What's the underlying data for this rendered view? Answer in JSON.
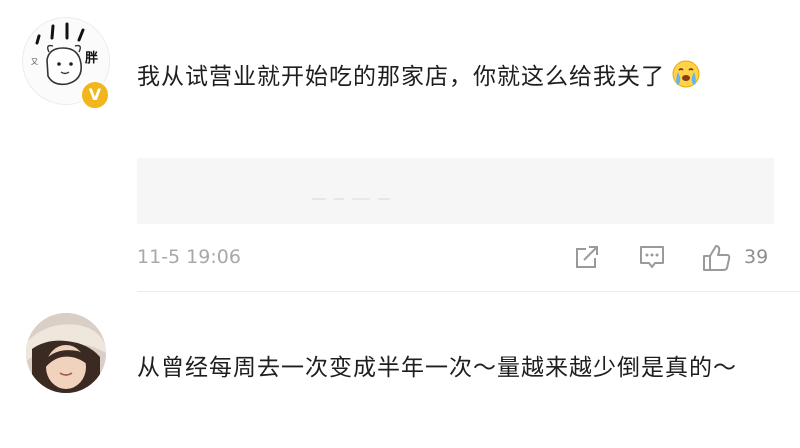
{
  "comments": [
    {
      "avatar_text": "胖",
      "avatar_small_text": "又",
      "verified": "V",
      "text": "我从试营业就开始吃的那家店，你就这么给我关了",
      "emoji": "crying-face-emoji",
      "time": "11-5 19:06",
      "likes": "39"
    },
    {
      "text": "从曾经每周去一次变成半年一次～量越来越少倒是真的～"
    }
  ],
  "icons": {
    "share": "share-icon",
    "comment": "comment-icon",
    "like": "thumbs-up-icon"
  },
  "colors": {
    "verified_badge": "#f2b51c",
    "meta_text": "#a8a8a8",
    "quote_background": "#f6f6f6"
  }
}
